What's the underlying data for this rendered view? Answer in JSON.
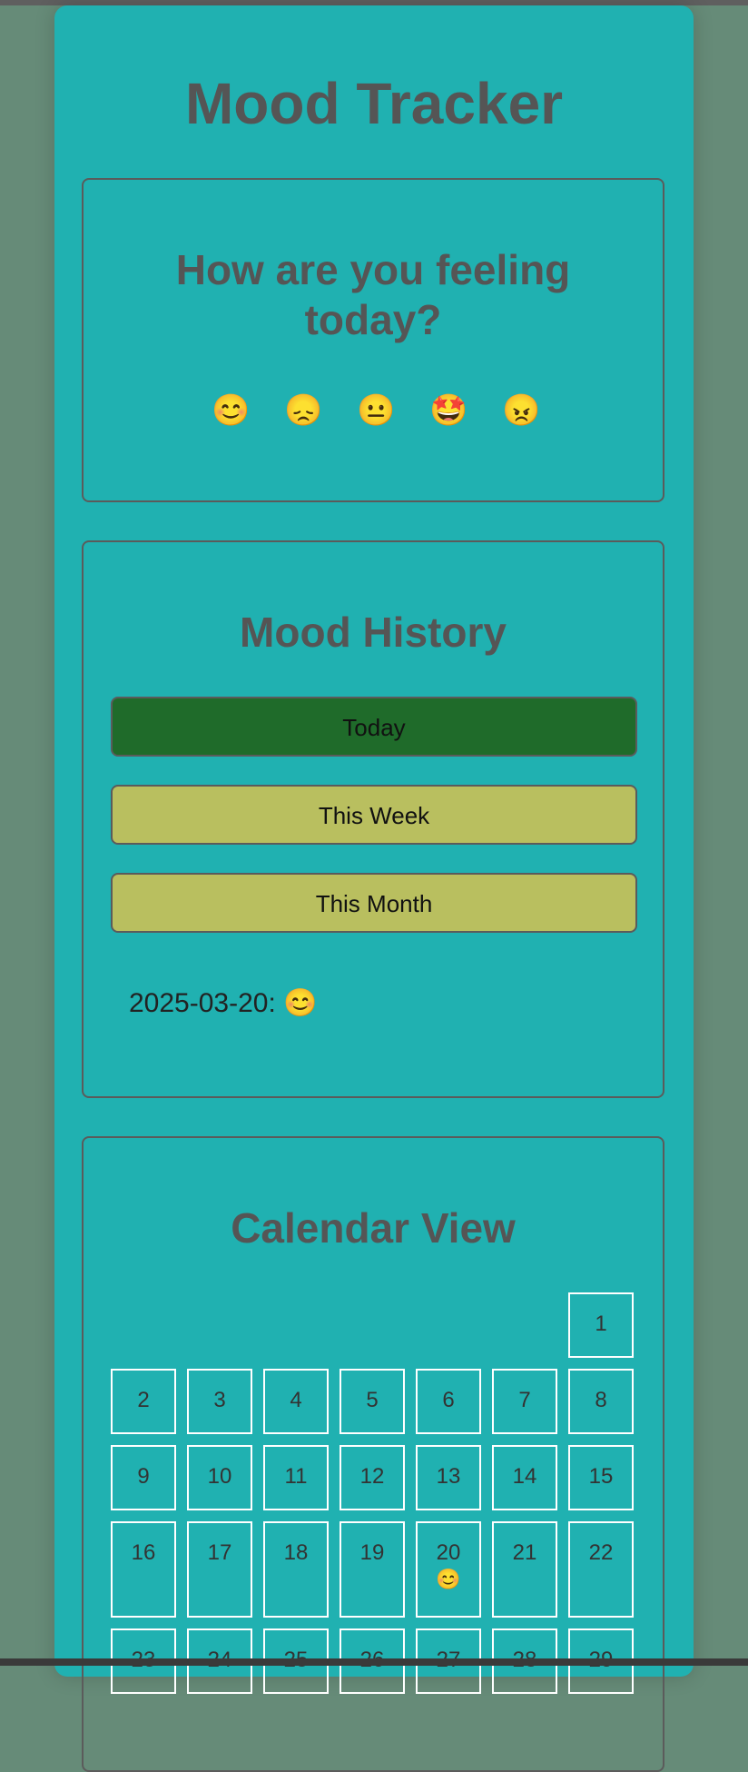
{
  "app": {
    "title": "Mood Tracker"
  },
  "mood_picker": {
    "question": "How are you feeling today?",
    "options": [
      "😊",
      "😞",
      "😐",
      "🤩",
      "😠"
    ]
  },
  "history": {
    "heading": "Mood History",
    "buttons": {
      "today": "Today",
      "week": "This Week",
      "month": "This Month"
    },
    "active_filter": "Today",
    "entry": "2025-03-20: 😊"
  },
  "calendar": {
    "heading": "Calendar View",
    "days": [
      {
        "day": "1",
        "mood": ""
      },
      {
        "day": "2",
        "mood": ""
      },
      {
        "day": "3",
        "mood": ""
      },
      {
        "day": "4",
        "mood": ""
      },
      {
        "day": "5",
        "mood": ""
      },
      {
        "day": "6",
        "mood": ""
      },
      {
        "day": "7",
        "mood": ""
      },
      {
        "day": "8",
        "mood": ""
      },
      {
        "day": "9",
        "mood": ""
      },
      {
        "day": "10",
        "mood": ""
      },
      {
        "day": "11",
        "mood": ""
      },
      {
        "day": "12",
        "mood": ""
      },
      {
        "day": "13",
        "mood": ""
      },
      {
        "day": "14",
        "mood": ""
      },
      {
        "day": "15",
        "mood": ""
      },
      {
        "day": "16",
        "mood": ""
      },
      {
        "day": "17",
        "mood": ""
      },
      {
        "day": "18",
        "mood": ""
      },
      {
        "day": "19",
        "mood": ""
      },
      {
        "day": "20",
        "mood": "😊"
      },
      {
        "day": "21",
        "mood": ""
      },
      {
        "day": "22",
        "mood": ""
      },
      {
        "day": "23",
        "mood": ""
      },
      {
        "day": "24",
        "mood": ""
      },
      {
        "day": "25",
        "mood": ""
      },
      {
        "day": "26",
        "mood": ""
      },
      {
        "day": "27",
        "mood": ""
      },
      {
        "day": "28",
        "mood": ""
      },
      {
        "day": "29",
        "mood": ""
      }
    ]
  },
  "colors": {
    "page_background": "#668b78",
    "card_background": "#20b1b1",
    "heading_text": "#555555",
    "active_button": "#1f6b2a",
    "inactive_button": "#b9bf5f",
    "calendar_cell_border": "#ffffff"
  }
}
